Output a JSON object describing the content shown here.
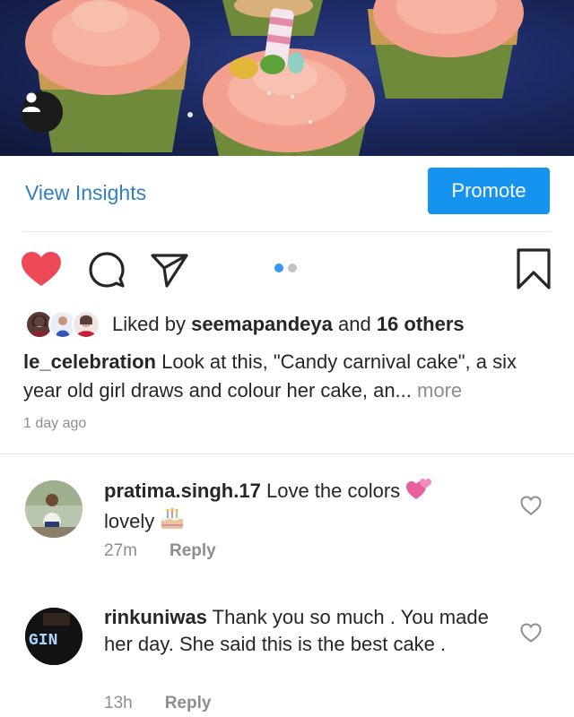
{
  "post": {
    "user_tag_icon": "person-icon"
  },
  "insights": {
    "view_insights_label": "View Insights",
    "promote_label": "Promote"
  },
  "actions": {
    "like_icon": "heart-filled-icon",
    "comment_icon": "comment-icon",
    "share_icon": "paper-plane-icon",
    "save_icon": "bookmark-icon",
    "carousel_count": 2,
    "carousel_active": 1
  },
  "likes": {
    "prefix": "Liked by",
    "user": "seemapandeya",
    "joiner": "and",
    "others": "16 others"
  },
  "caption": {
    "username": "le_celebration",
    "text": "Look at this, \"Candy carnival cake\", a six year old girl draws and colour her cake, an...",
    "more": "more"
  },
  "time_ago": "1 day ago",
  "comments": [
    {
      "username": "pratima.singh.17",
      "text_a": "Love the colors",
      "text_b": "lovely",
      "time": "27m",
      "reply": "Reply",
      "emoji_a": "two-hearts-emoji",
      "emoji_b": "birthday-cake-emoji"
    },
    {
      "username": "rinkuniwas",
      "text": "Thank you so much . You made her day. She said this is the best cake .",
      "time": "13h",
      "reply": "Reply",
      "avatar_text": "GIN"
    }
  ],
  "colors": {
    "like_red": "#ed4956",
    "link_blue": "#2f7fc1",
    "promote_blue": "#1593ee",
    "muted_gray": "#8e8e8e"
  }
}
